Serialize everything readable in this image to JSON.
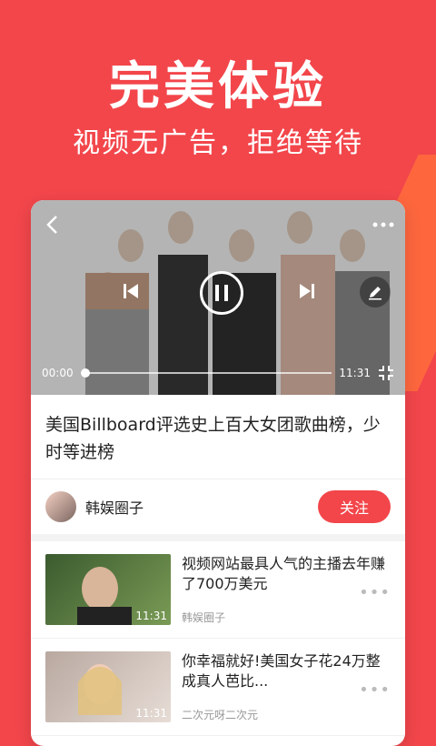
{
  "headline": "完美体验",
  "subline": "视频无广告，拒绝等待",
  "colors": {
    "brand_red": "#f2464b",
    "accent_orange": "#ff6a3d"
  },
  "video": {
    "current_time": "00:00",
    "duration": "11:31",
    "progress_fraction": 0.0,
    "icons": [
      "back-icon",
      "more-icon",
      "prev-icon",
      "pause-icon",
      "next-icon",
      "edit-icon",
      "fullscreen-exit-icon"
    ]
  },
  "video_title": "美国Billboard评选史上百大女团歌曲榜，少时等进榜",
  "author": {
    "name": "韩娱圈子",
    "follow_label": "关注"
  },
  "list": [
    {
      "title": "视频网站最具人气的主播去年赚了700万美元",
      "source": "韩娱圈子",
      "duration": "11:31"
    },
    {
      "title": "你幸福就好!美国女子花24万整成真人芭比...",
      "source": "二次元呀二次元",
      "duration": "11:31"
    }
  ]
}
